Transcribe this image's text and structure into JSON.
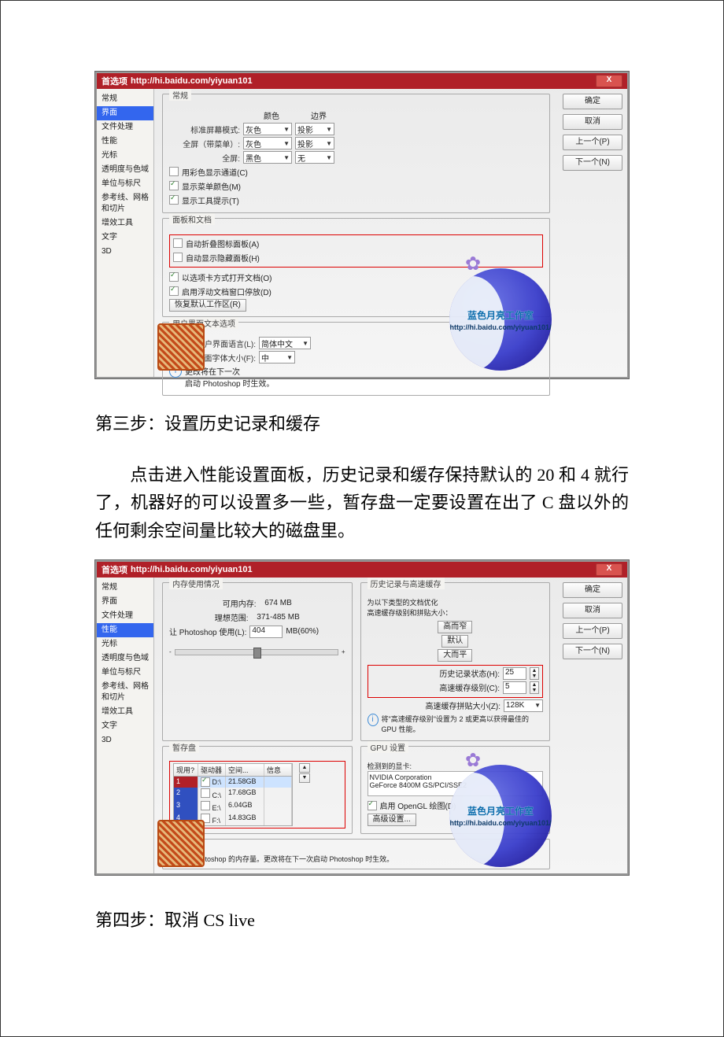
{
  "titlebar_prefix": "首选项",
  "titlebar_url": "http://hi.baidu.com/yiyuan101",
  "close_x": "X",
  "action_buttons": {
    "ok": "确定",
    "cancel": "取消",
    "prev": "上一个(P)",
    "next": "下一个(N)"
  },
  "sidebar_items": [
    "常规",
    "界面",
    "文件处理",
    "性能",
    "光标",
    "透明度与色域",
    "单位与标尺",
    "参考线、网格和切片",
    "增效工具",
    "文字",
    "3D"
  ],
  "dialog1": {
    "selected": 1,
    "group_general": "常规",
    "col_color": "颜色",
    "col_border": "边界",
    "row1_label": "标准屏幕模式:",
    "row1_val": "灰色",
    "row1_border": "投影",
    "row2_label": "全屏（带菜单）:",
    "row2_val": "灰色",
    "row2_border": "投影",
    "row3_label": "全屏:",
    "row3_val": "黑色",
    "row3_border": "无",
    "cb_color_channels": "用彩色显示通道(C)",
    "cb_menu_colors": "显示菜单颜色(M)",
    "cb_tooltips": "显示工具提示(T)",
    "group_panels": "面板和文档",
    "cb_autocollapse": "自动折叠图标面板(A)",
    "cb_autoshow": "自动显示隐藏面板(H)",
    "cb_tabbed": "以选项卡方式打开文档(O)",
    "cb_floating": "启用浮动文档窗口停放(D)",
    "restore_btn": "恢复默认工作区(R)",
    "group_ui_text": "用户界面文本选项",
    "ui_lang_label": "用户界面语言(L):",
    "ui_lang_val": "简体中文",
    "ui_font_label": "用户界面字体大小(F):",
    "ui_font_val": "中",
    "restart_note": "更改将在下一次\n启动 Photoshop 时生效。"
  },
  "dialog2": {
    "selected": 3,
    "group_mem": "内存使用情况",
    "avail_label": "可用内存:",
    "avail_val": "674 MB",
    "ideal_label": "理想范围:",
    "ideal_val": "371-485 MB",
    "let_label": "让 Photoshop 使用(L):",
    "let_val": "404",
    "let_unit": "MB(60%)",
    "group_hist": "历史记录与高速缓存",
    "hist_note": "为以下类型的文档优化\n高速缓存级别和拼贴大小：",
    "preset_tall": "高而窄",
    "preset_default": "默认",
    "preset_big": "大而平",
    "hist_states_label": "历史记录状态(H):",
    "hist_states_val": "25",
    "cache_levels_label": "高速缓存级别(C):",
    "cache_levels_val": "5",
    "cache_tile_label": "高速缓存拼贴大小(Z):",
    "cache_tile_val": "128K",
    "cache_tip": "将\"高速缓存级别\"设置为 2 或更高以获得最佳的 GPU 性能。",
    "group_scratch": "暂存盘",
    "col_active": "现用?",
    "col_drive": "驱动器",
    "col_space": "空间...",
    "col_info": "信息",
    "drives": [
      {
        "idx": "1",
        "chk": true,
        "name": "D:\\",
        "space": "21.58GB"
      },
      {
        "idx": "2",
        "chk": false,
        "name": "C:\\",
        "space": "17.68GB"
      },
      {
        "idx": "3",
        "chk": false,
        "name": "E:\\",
        "space": "6.04GB"
      },
      {
        "idx": "4",
        "chk": false,
        "name": "F:\\",
        "space": "14.83GB"
      }
    ],
    "group_gpu": "GPU 设置",
    "gpu_detected": "检测到的显卡:",
    "gpu_name": "NVIDIA Corporation\nGeForce 8400M GS/PCI/SSE2",
    "cb_opengl": "启用 OpenGL 绘图(D)",
    "adv_btn": "高级设置...",
    "group_desc": "说明",
    "desc_text": "分配给 Photoshop 的内存量。更改将在下一次启动 Photoshop 时生效。"
  },
  "watermark_text": "蓝色月亮工作室",
  "watermark_url": "http://hi.baidu.com/yiyuan101/",
  "step3_heading": "第三步：设置历史记录和缓存",
  "step3_body": "点击进入性能设置面板，历史记录和缓存保持默认的 20 和 4 就行了，机器好的可以设置多一些，暂存盘一定要设置在出了 C 盘以外的任何剩余空间量比较大的磁盘里。",
  "step4_heading": "第四步：取消 CS live"
}
